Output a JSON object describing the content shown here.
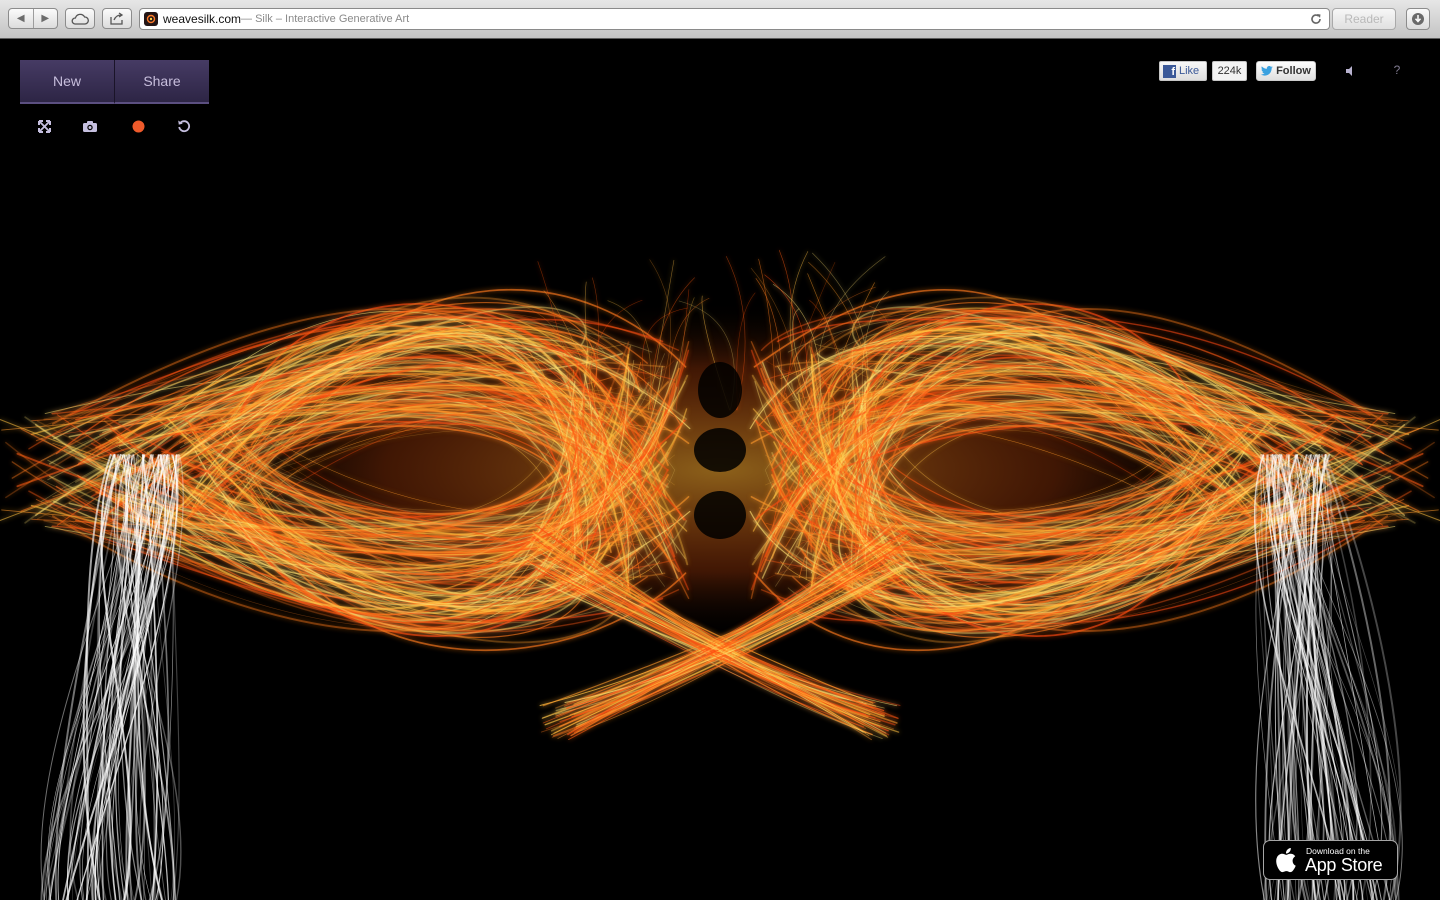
{
  "browser": {
    "url_domain": "weavesilk.com",
    "url_title": " — Silk – Interactive Generative Art",
    "reader_label": "Reader"
  },
  "toolbar": {
    "new_label": "New",
    "share_label": "Share",
    "tools": [
      "fullscreen-icon",
      "camera-icon",
      "record-icon",
      "undo-icon"
    ],
    "record_color": "#ee5a2b"
  },
  "social": {
    "like_label": "Like",
    "like_count": "224k",
    "follow_label": "Follow",
    "help_label": "?"
  },
  "app_store": {
    "small_text": "Download on the",
    "big_text": "App Store"
  },
  "colors": {
    "tab_purple": "#3d3358",
    "silk_orange": "#ff6a1a",
    "silk_yellow": "#ffd24a",
    "silk_white": "#ffffff"
  }
}
